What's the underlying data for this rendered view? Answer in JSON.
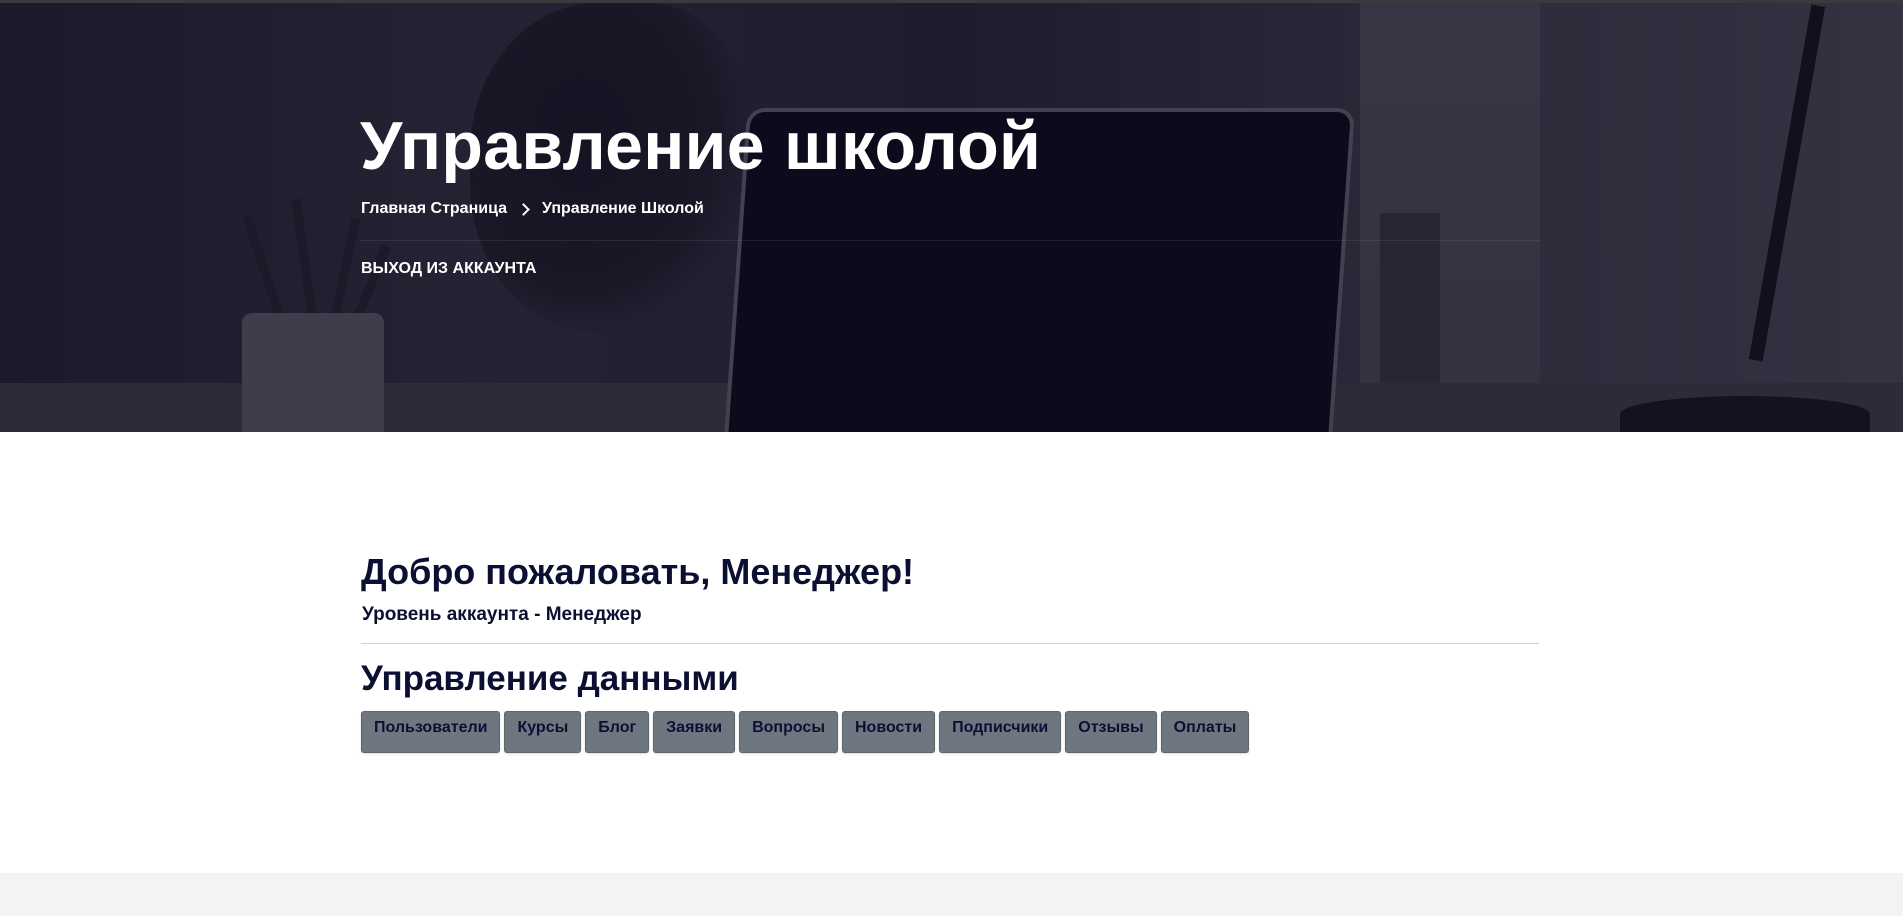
{
  "hero": {
    "title": "Управление школой",
    "breadcrumb": {
      "home": "Главная Страница",
      "current": "Управление Школой"
    },
    "logout": "ВЫХОД ИЗ АККАУНТА"
  },
  "main": {
    "welcome": "Добро пожаловать, Менеджер!",
    "account_level": "Уровень аккаунта - Менеджер",
    "section_title": "Управление данными",
    "buttons": [
      "Пользователи",
      "Курсы",
      "Блог",
      "Заявки",
      "Вопросы",
      "Новости",
      "Подписчики",
      "Отзывы",
      "Оплаты"
    ]
  },
  "colors": {
    "text": "#0b1033",
    "button_bg": "#6e7780",
    "footer_bg": "#f3f3f3"
  },
  "icons": {
    "breadcrumb_separator": "chevron-right-icon"
  }
}
